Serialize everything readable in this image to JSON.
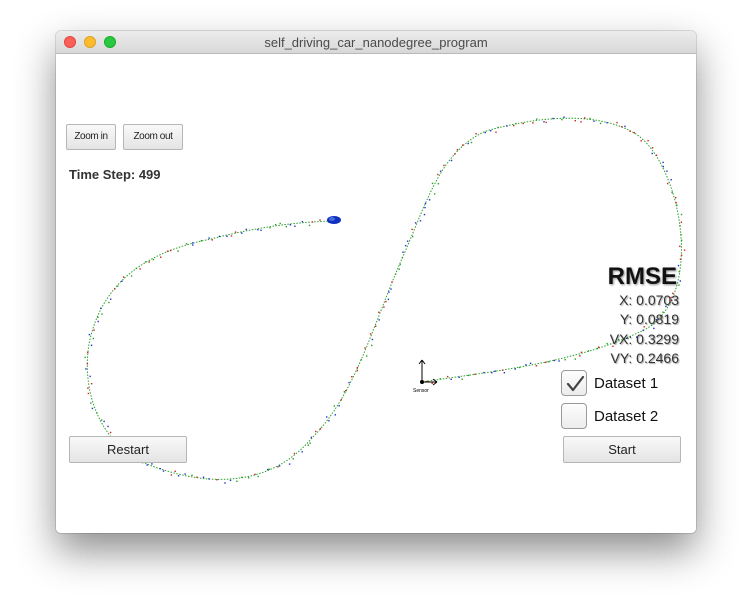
{
  "window": {
    "title": "self_driving_car_nanodegree_program"
  },
  "controls": {
    "zoom_in_label": "Zoom in",
    "zoom_out_label": "Zoom out",
    "restart_label": "Restart",
    "start_label": "Start"
  },
  "status": {
    "time_step": "Time Step: 499"
  },
  "rmse": {
    "title": "RMSE",
    "x": "X: 0.0703",
    "y": "Y: 0.0819",
    "vx": "VX: 0.3299",
    "vy": "VY: 0.2466"
  },
  "datasets": [
    {
      "label": "Dataset 1",
      "checked": true
    },
    {
      "label": "Dataset 2",
      "checked": false
    }
  ],
  "sensor_label": "Sensor",
  "colors": {
    "trajectory": "#2aa02a",
    "radar": "#2030d0",
    "lidar": "#d02020",
    "car": "#1030c0",
    "close": "#fc5f57",
    "minimize": "#fdbc2e",
    "maximize": "#28c940"
  }
}
